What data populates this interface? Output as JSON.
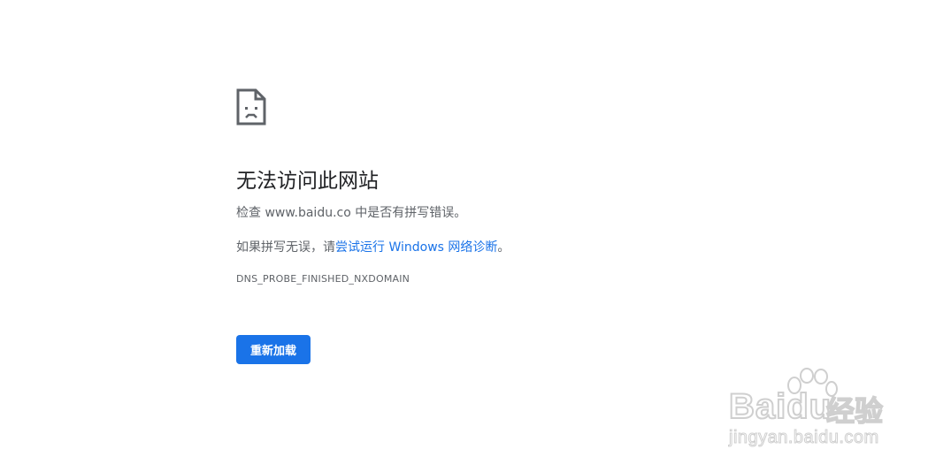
{
  "error": {
    "icon": "sad-document-icon",
    "title": "无法访问此网站",
    "check_prefix": "检查 ",
    "check_domain": "www.baidu.co",
    "check_suffix": " 中是否有拼写错误。",
    "suggest_prefix": "如果拼写无误，请",
    "suggest_link": "尝试运行 Windows 网络诊断",
    "suggest_suffix": "。",
    "code": "DNS_PROBE_FINISHED_NXDOMAIN",
    "reload_label": "重新加载",
    "accent_color": "#1a73e8"
  },
  "watermark": {
    "logo_text": "Baidu",
    "product_text": "经验",
    "url_text": "jingyan.baidu.com"
  }
}
